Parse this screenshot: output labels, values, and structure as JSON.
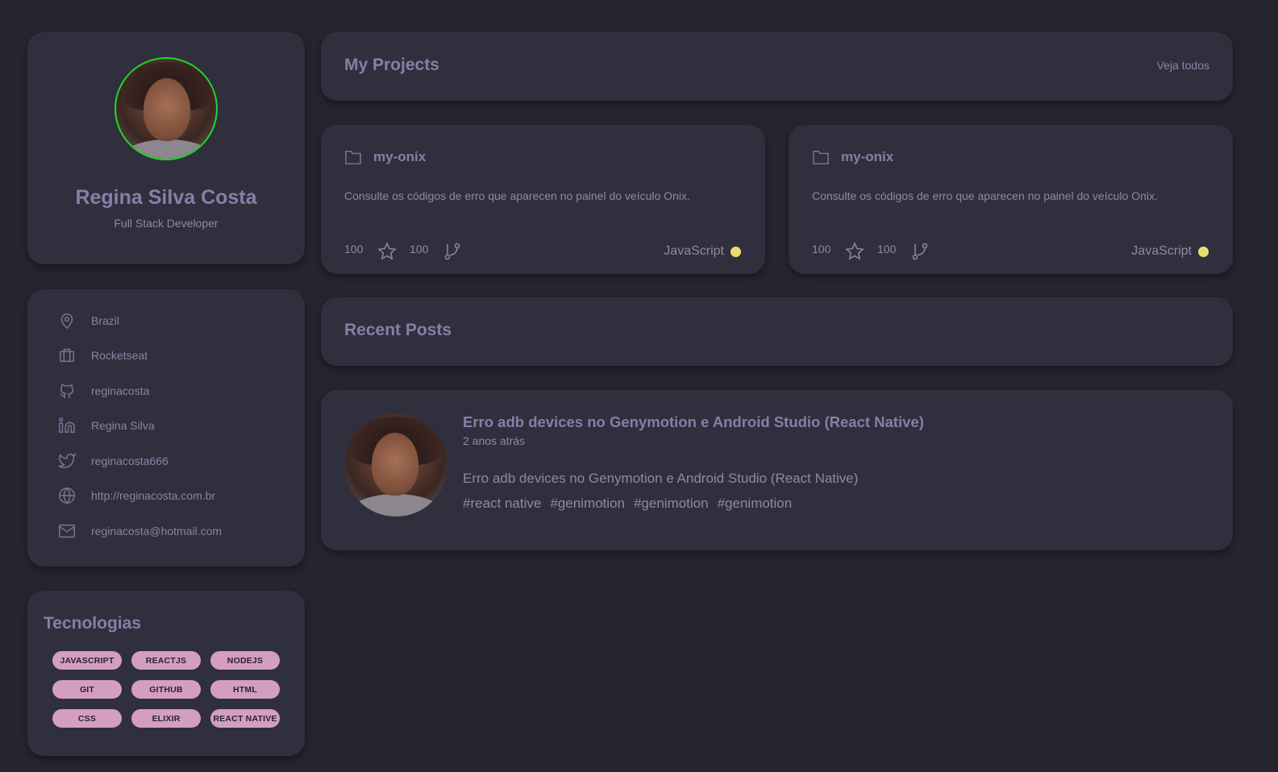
{
  "profile": {
    "name": "Regina Silva Costa",
    "role": "Full Stack Developer"
  },
  "info": {
    "location": "Brazil",
    "company": "Rocketseat",
    "github": "reginacosta",
    "linkedin": "Regina Silva",
    "twitter": "reginacosta666",
    "website": "http://reginacosta.com.br",
    "email": "reginacosta@hotmail.com"
  },
  "technologies": {
    "title": "Tecnologias",
    "tags": [
      "JAVASCRIPT",
      "REACTJS",
      "NODEJS",
      "GIT",
      "GITHUB",
      "HTML",
      "CSS",
      "ELIXIR",
      "REACT NATIVE"
    ]
  },
  "projects": {
    "title": "My Projects",
    "see_all": "Veja todos",
    "items": [
      {
        "name": "my-onix",
        "description": "Consulte os códigos de erro que aparecen no painel do veículo Onix.",
        "stars": "100",
        "forks": "100",
        "language": "JavaScript"
      },
      {
        "name": "my-onix",
        "description": "Consulte os códigos de erro que aparecen no painel do veículo Onix.",
        "stars": "100",
        "forks": "100",
        "language": "JavaScript"
      }
    ]
  },
  "posts": {
    "title": "Recent Posts",
    "items": [
      {
        "title": "Erro adb devices no Genymotion e Android Studio (React Native)",
        "time": "2 anos atrás",
        "body": "Erro adb devices no Genymotion e Android Studio (React Native)",
        "tags": [
          "#react native",
          "#genimotion",
          "#genimotion",
          "#genimotion"
        ]
      }
    ]
  },
  "colors": {
    "background": "#25242f",
    "card": "#302f3d",
    "avatar_ring": "#22d624",
    "tag_bg": "#d49ec0",
    "language_dot": "#e8dd6c"
  }
}
